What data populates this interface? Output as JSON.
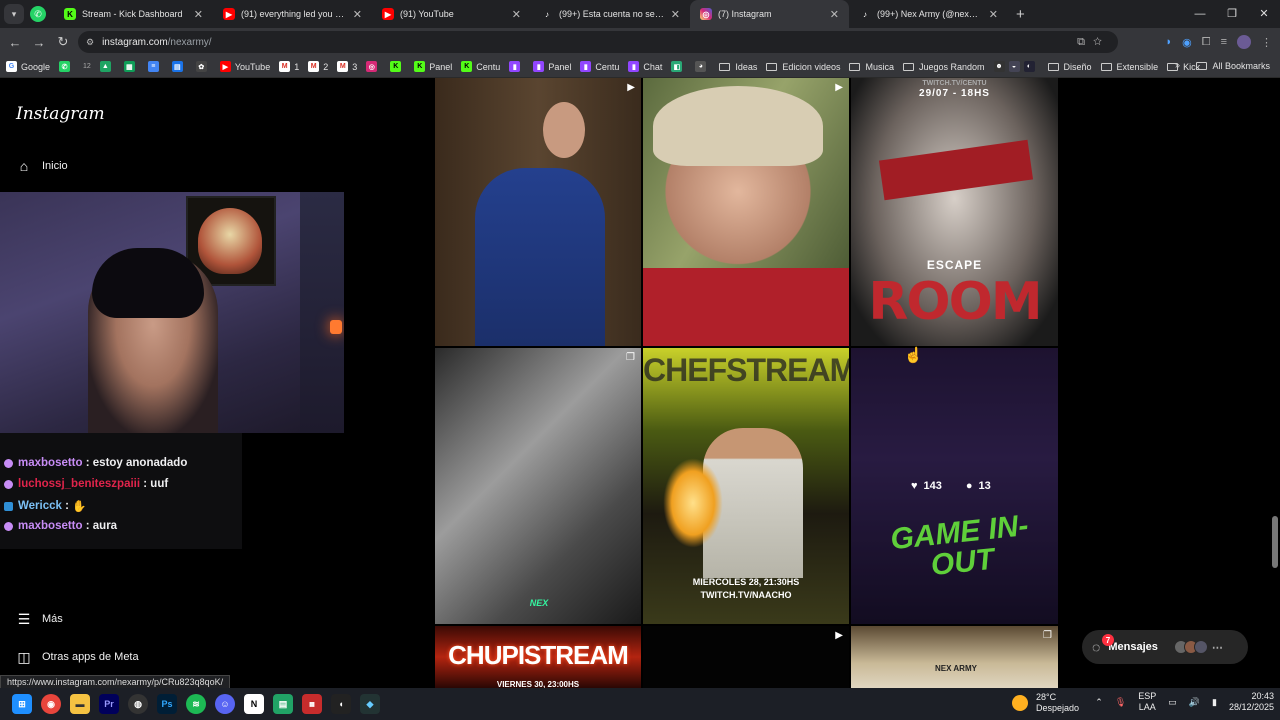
{
  "browser": {
    "tabs": [
      {
        "title": "Stream - Kick Dashboard",
        "icon": "kick-icon",
        "color": "#53fc18"
      },
      {
        "title": "(91) everything led you here - Y",
        "icon": "youtube-icon",
        "color": "#ff0000"
      },
      {
        "title": "(91) YouTube",
        "icon": "youtube-icon",
        "color": "#ff0000"
      },
      {
        "title": "(99+) Esta cuenta no se encuentra",
        "icon": "tiktok-icon",
        "color": "#000000"
      },
      {
        "title": "(7) Instagram",
        "icon": "instagram-icon",
        "color": "#d62976"
      },
      {
        "title": "(99+) Nex Army (@nexarmy.clip",
        "icon": "tiktok-icon",
        "color": "#000000"
      }
    ],
    "url_domain": "instagram.com",
    "url_path": "/nexarmy/",
    "bookmarks": [
      "Google",
      "12",
      "YouTube",
      "1",
      "2",
      "3",
      "Panel",
      "Centu",
      "Panel",
      "Centu",
      "Chat",
      "Ideas",
      "Edicion videos",
      "Musica",
      "Juegos Random",
      "Diseño",
      "Extensible",
      "Kick"
    ],
    "all_bookmarks": "All Bookmarks"
  },
  "instagram": {
    "logo": "Instagram",
    "nav_home": "Inicio",
    "nav_more": "Más",
    "nav_meta": "Otras apps de Meta",
    "messages": "Mensajes",
    "messages_badge": "7",
    "hover_likes": "143",
    "hover_comments": "13",
    "posts": [
      {
        "text": ""
      },
      {
        "text": ""
      },
      {
        "top": "TWITCH.TV/CENTU",
        "date": "29/07  -  18HS",
        "small": "ESCAPE",
        "big": "ROOM"
      },
      {
        "text": "NEX"
      },
      {
        "top": "CHEFSTREAM",
        "date": "MIERCOLES 28, 21:30HS",
        "link": "TWITCH.TV/NAACHO"
      },
      {
        "big": "GAME IN-OUT"
      },
      {
        "big": "CHUPISTREAM",
        "date": "VIERNES 30, 23:00HS"
      },
      {
        "text": ""
      },
      {
        "text": "NEX ARMY"
      }
    ]
  },
  "stream": {
    "chat": [
      {
        "user": "maxbosetto",
        "msg": ": estoy anonadado",
        "color": "#c78cf5"
      },
      {
        "user": "luchossj_beniteszpaiii",
        "msg": ": uuf",
        "color": "#e0244b"
      },
      {
        "user": "Wericck",
        "msg": ":",
        "color": "#7cc0f5"
      },
      {
        "user": "maxbosetto",
        "msg": ": aura",
        "color": "#c78cf5"
      }
    ]
  },
  "status_url": "https://www.instagram.com/nexarmy/p/CRu823q8qoK/",
  "system": {
    "temp": "28°C",
    "weather": "Despejado",
    "lang1": "ESP",
    "lang2": "LAA",
    "time": "20:43",
    "date": "28/12/2025"
  }
}
